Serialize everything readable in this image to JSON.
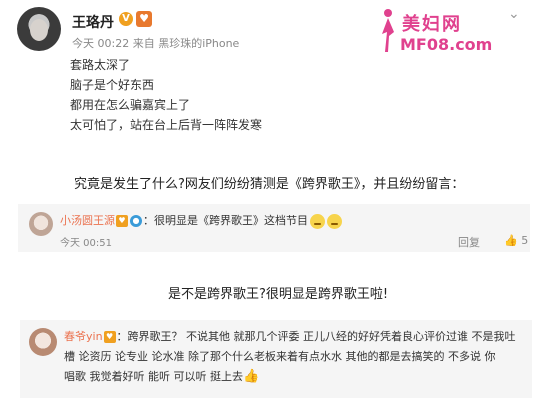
{
  "post1": {
    "username": "王珞丹",
    "badge_v": "V",
    "badge_heart": "♥",
    "meta": "今天 00:22 来自 黑珍珠的iPhone",
    "lines": [
      "套路太深了",
      "脑子是个好东西",
      "都用在怎么骗嘉宾上了",
      "太可怕了，站在台上后背一阵阵发寒"
    ],
    "menu_glyph": "⌄"
  },
  "watermark": {
    "title": "美妇网",
    "url": "MF08.com"
  },
  "caption1": "究竟是发生了什么?网友们纷纷猜测是《跨界歌王》，并且纷纷留言：",
  "comment1": {
    "name": "小汤圆王源",
    "separator": "：",
    "text": "很明显是《跨界歌王》这档节目",
    "time": "今天 00:51",
    "reply": "回复",
    "likes": "5",
    "like_icon": "👍"
  },
  "caption2": "是不是跨界歌王?很明显是跨界歌王啦!",
  "comment2": {
    "name": "春爷yin",
    "separator": "：",
    "line1": "跨界歌王？ 不说其他 就那几个评委 正儿八经的好好凭着良心评价过谁 不是我吐",
    "line2": "槽 论资历 论专业 论水准 除了那个什么老板来着有点水水 其他的都是去搞笑的 不多说 你",
    "line3": "唱歌 我觉着好听 能听 可以听 挺上去",
    "thumb_icon": "👍"
  }
}
